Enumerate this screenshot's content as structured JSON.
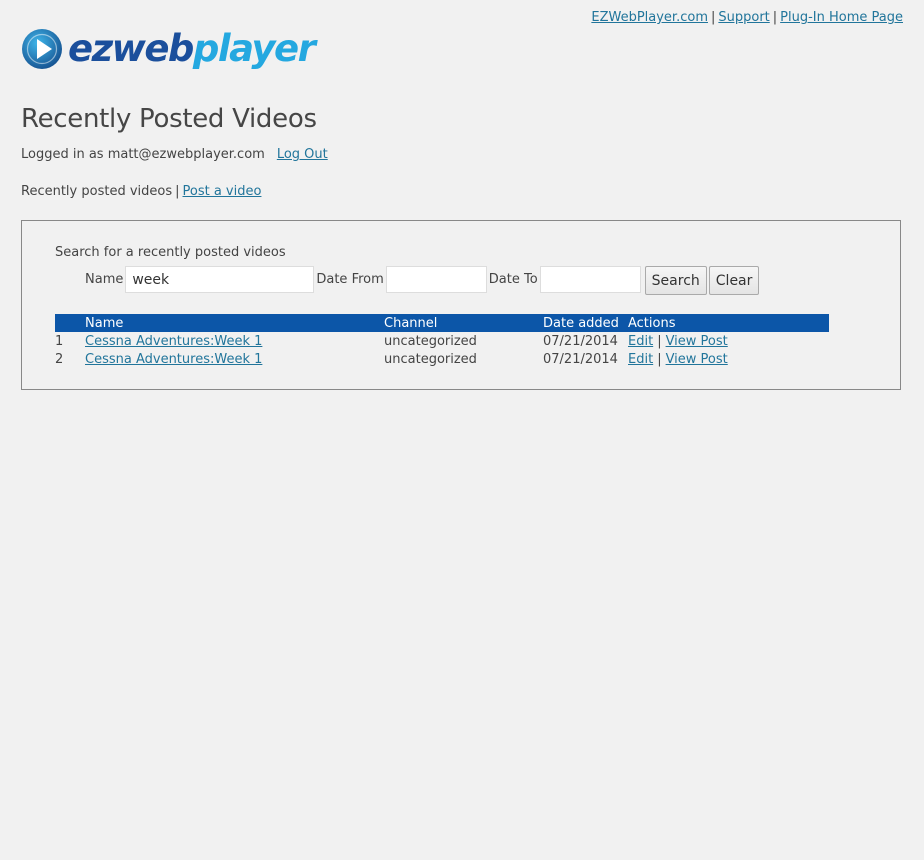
{
  "header": {
    "links": [
      {
        "label": "EZWebPlayer.com"
      },
      {
        "label": "Support"
      },
      {
        "label": "Plug-In Home Page"
      }
    ],
    "separator": "|"
  },
  "logo": {
    "text_part1": "ez",
    "text_part2": "web",
    "text_part3": "player",
    "colors": {
      "dark_blue": "#1b4f9c",
      "light_blue": "#24a8e0"
    }
  },
  "page": {
    "title": "Recently Posted Videos",
    "logged_in_text": "Logged in as matt@ezwebplayer.com",
    "logout_label": "Log Out"
  },
  "subnav": {
    "current": "Recently posted videos",
    "separator": "|",
    "post_link": "Post a video"
  },
  "search": {
    "heading": "Search for a recently posted videos",
    "name_label": "Name",
    "name_value": "week",
    "date_from_label": "Date From",
    "date_from_value": "",
    "date_to_label": "Date To",
    "date_to_value": "",
    "search_button": "Search",
    "clear_button": "Clear"
  },
  "table": {
    "header_color": "#0c56a8",
    "columns": [
      "",
      "Name",
      "Channel",
      "Date added",
      "Actions"
    ],
    "rows": [
      {
        "num": "1",
        "name": "Cessna Adventures:Week 1",
        "channel": "uncategorized",
        "date": "07/21/2014",
        "edit": "Edit",
        "view": "View Post"
      },
      {
        "num": "2",
        "name": "Cessna Adventures:Week 1",
        "channel": "uncategorized",
        "date": "07/21/2014",
        "edit": "Edit",
        "view": "View Post"
      }
    ],
    "action_separator": "|"
  }
}
